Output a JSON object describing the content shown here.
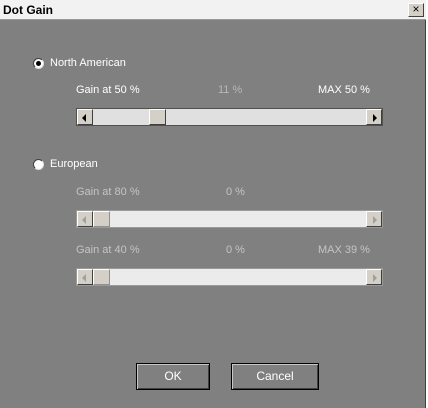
{
  "window": {
    "title": "Dot Gain",
    "close_label": "×"
  },
  "north_american": {
    "label": "North American",
    "selected": true,
    "gain_label": "Gain at 50 %",
    "value": "11 %",
    "max_label": "MAX 50 %",
    "slider_fraction": 0.22
  },
  "european": {
    "label": "European",
    "selected": false,
    "row1": {
      "gain_label": "Gain at 80 %",
      "value": "0 %",
      "slider_fraction": 0
    },
    "row2": {
      "gain_label": "Gain at 40 %",
      "value": "0 %",
      "max_label": "MAX 39 %",
      "slider_fraction": 0
    }
  },
  "buttons": {
    "ok": "OK",
    "cancel": "Cancel"
  },
  "colors": {
    "dialog_bg": "#808080",
    "active_text": "#ffffff",
    "disabled_text": "#c4c4c4"
  }
}
